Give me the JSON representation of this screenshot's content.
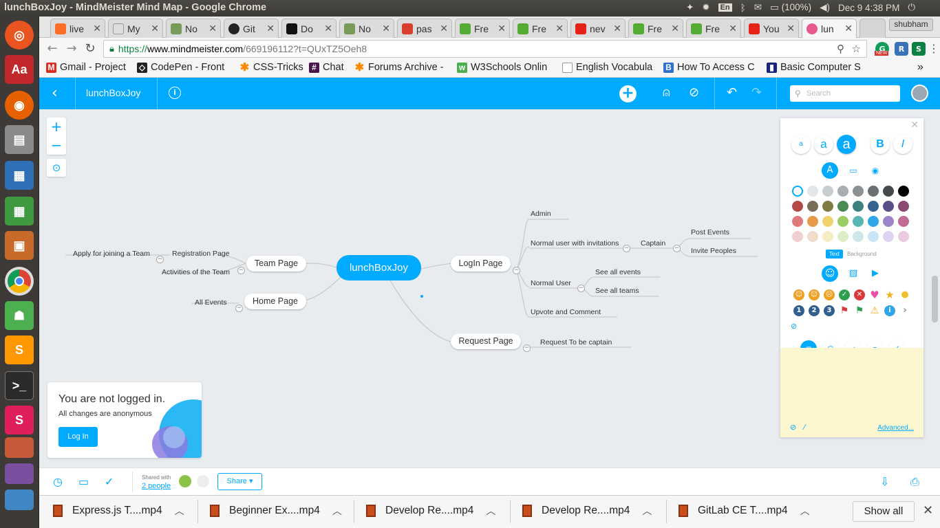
{
  "os": {
    "window_title": "lunchBoxJoy - MindMeister Mind Map - Google Chrome",
    "lang": "En",
    "battery": "(100%)",
    "clock": "Dec  9  4:38 PM",
    "user": "shubham"
  },
  "tabs": [
    {
      "label": "live",
      "color": "#fc6d26"
    },
    {
      "label": "My",
      "color": "#888888"
    },
    {
      "label": "No",
      "color": "#7a9a5a"
    },
    {
      "label": "Git",
      "color": "#222222"
    },
    {
      "label": "Do",
      "color": "#111111"
    },
    {
      "label": "No",
      "color": "#7a9a5a"
    },
    {
      "label": "pas",
      "color": "#d8402b"
    },
    {
      "label": "Fre",
      "color": "#55aa33"
    },
    {
      "label": "Fre",
      "color": "#55aa33"
    },
    {
      "label": "nev",
      "color": "#e62117"
    },
    {
      "label": "Fre",
      "color": "#55aa33"
    },
    {
      "label": "Fre",
      "color": "#55aa33"
    },
    {
      "label": "You",
      "color": "#e62117"
    },
    {
      "label": "lun",
      "color": "#e85a8f"
    }
  ],
  "url": {
    "scheme": "https://",
    "host": "www.mindmeister.com",
    "path": "/669196112?t=QUxTZ5Oeh8"
  },
  "extensions": {
    "new_badge": "NEW"
  },
  "bookmarks": [
    {
      "label": "Gmail - Project",
      "icon": "gmail-icon",
      "color": "#d93025"
    },
    {
      "label": "CodePen - Front",
      "icon": "codepen-icon",
      "color": "#222222"
    },
    {
      "label": "CSS-Tricks",
      "icon": "asterisk-icon",
      "color": "#ff8a00"
    },
    {
      "label": "Chat",
      "icon": "slack-icon",
      "color": "#4a154b"
    },
    {
      "label": "Forums Archive -",
      "icon": "asterisk-icon",
      "color": "#ff8a00"
    },
    {
      "label": "W3Schools Onlin",
      "icon": "w3-icon",
      "color": "#4caf50"
    },
    {
      "label": "English Vocabula",
      "icon": "page-icon",
      "color": "#999999"
    },
    {
      "label": "How To Access C",
      "icon": "b-icon",
      "color": "#2f6fd0"
    },
    {
      "label": "Basic Computer S",
      "icon": "book-icon",
      "color": "#1a237e"
    }
  ],
  "mm_header": {
    "title": "lunchBoxJoy",
    "search_placeholder": "Search"
  },
  "map": {
    "root": "lunchBoxJoy",
    "nodes": {
      "team": "Team Page",
      "home": "Home Page",
      "login": "LogIn Page",
      "request": "Request Page"
    },
    "leaves": {
      "apply": "Apply for joining a Team",
      "registration": "Registration Page",
      "activities": "Activities of the Team",
      "all_events": "All Events",
      "admin": "Admin",
      "normal_inv": "Normal user with invitations",
      "captain": "Captain",
      "post_events": "Post Events",
      "invite": "Invite Peoples",
      "normal_user": "Normal User",
      "see_events": "See all events",
      "see_teams": "See all teams",
      "upvote": "Upvote and Comment",
      "request_captain": "Request To be captain"
    }
  },
  "panel": {
    "font_small": "a",
    "font_medium": "a",
    "font_large": "a",
    "bold": "B",
    "italic": "I",
    "toggle_text": "Text",
    "toggle_background": "Background",
    "advanced": "Advanced...",
    "colors": [
      [
        "#ffffff",
        "#e3e6e8",
        "#c8cdd0",
        "#a9aeb1",
        "#8c9194",
        "#6b7073",
        "#44494c",
        "#000000"
      ],
      [
        "#b44a48",
        "#7a6e58",
        "#7e7b43",
        "#4b8a52",
        "#3f7f80",
        "#35628f",
        "#5a4f86",
        "#8a4a6f"
      ],
      [
        "#e0797b",
        "#e79b4a",
        "#f0d36e",
        "#9ccc65",
        "#5ab6b2",
        "#2fa6e8",
        "#9a86c6",
        "#c06a94"
      ],
      [
        "#f1d0d1",
        "#efdcc9",
        "#f5ecc2",
        "#dceec7",
        "#cbe8e6",
        "#c8e6f5",
        "#ddd4ef",
        "#eccbdc"
      ]
    ]
  },
  "login_box": {
    "heading": "You are not logged in.",
    "sub": "All changes are anonymous",
    "button": "Log In"
  },
  "footer": {
    "shared_with": "Shared with",
    "people": "2 people",
    "share": "Share ▾"
  },
  "downloads": {
    "items": [
      "Express.js T....mp4",
      "Beginner Ex....mp4",
      "Develop Re....mp4",
      "Develop Re....mp4",
      "GitLab CE T....mp4"
    ],
    "show_all": "Show all"
  }
}
